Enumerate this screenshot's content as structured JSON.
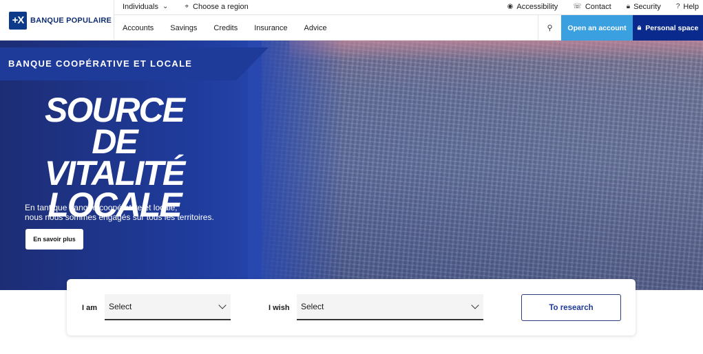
{
  "logo": {
    "mark": "+X",
    "name": "BANQUE POPULAIRE"
  },
  "topbar": {
    "segment": "Individuals",
    "region": "Choose a region",
    "right": [
      "Accessibility",
      "Contact",
      "Security",
      "Help"
    ]
  },
  "nav": {
    "items": [
      "Accounts",
      "Savings",
      "Credits",
      "Insurance",
      "Advice"
    ],
    "open_account": "Open an account",
    "personal_space": "Personal space"
  },
  "hero": {
    "banner": "BANQUE COOPÉRATIVE ET LOCALE",
    "headline": [
      "SOURCE",
      "DE VITALITÉ",
      "LOCALE"
    ],
    "sub_line1": "En tant que banque coopérative et locale,",
    "sub_line2": "nous nous sommes engagés sur tous les territoires.",
    "button": "En savoir plus"
  },
  "search": {
    "i_am_label": "I am",
    "i_am_value": "Select",
    "i_wish_label": "I wish",
    "i_wish_value": "Select",
    "button": "To research"
  },
  "colors": {
    "brand_blue": "#0b2a8e",
    "accent_blue": "#3aa0e0"
  }
}
